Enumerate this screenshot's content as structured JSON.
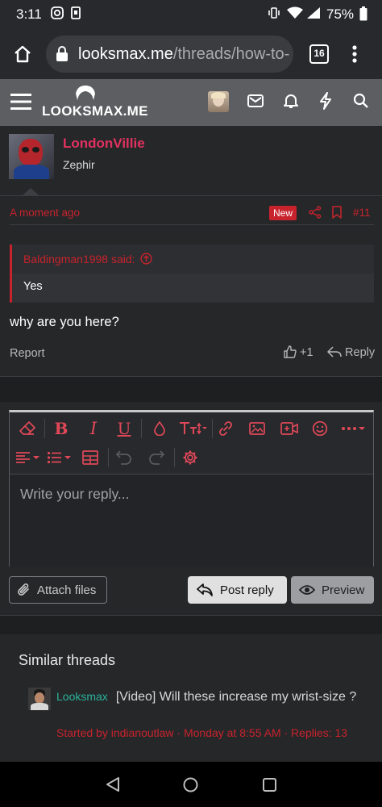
{
  "status_bar": {
    "time": "3:11",
    "battery": "75%"
  },
  "browser": {
    "url_domain": "looksmax.me",
    "url_path": "/threads/how-to-",
    "tab_count": "16"
  },
  "site": {
    "logo_text": "LOOKSMAX.ME"
  },
  "post": {
    "username": "LondonVillie",
    "user_title": "Zephir",
    "time": "A moment ago",
    "badge": "New",
    "post_number": "#11",
    "quote_author": "Baldingman1998 said:",
    "quote_text": "Yes",
    "message": "why are you here?",
    "report_label": "Report",
    "like_count": "+1",
    "reply_label": "Reply"
  },
  "editor": {
    "placeholder": "Write your reply...",
    "attach_label": "Attach files",
    "post_reply_label": "Post reply",
    "preview_label": "Preview"
  },
  "similar": {
    "title": "Similar threads",
    "items": [
      {
        "prefix": "Looksmax",
        "title": "[Video] Will these increase my wrist-size ?",
        "meta": "Started by indianoutlaw · Monday at 8:55 AM · Replies: 13"
      }
    ]
  },
  "colors": {
    "accent": "#c8232d",
    "username": "#e3315f",
    "prefix": "#2bb39a"
  }
}
